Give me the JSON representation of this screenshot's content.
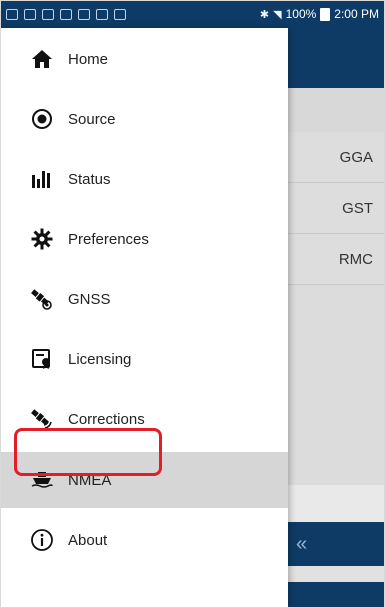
{
  "status_bar": {
    "bluetooth": "✱",
    "signal": "◥",
    "battery": "100%",
    "time": "2:00 PM"
  },
  "drawer": {
    "items": [
      {
        "label": "Home",
        "icon": "home-icon"
      },
      {
        "label": "Source",
        "icon": "source-icon"
      },
      {
        "label": "Status",
        "icon": "status-icon"
      },
      {
        "label": "Preferences",
        "icon": "gear-icon"
      },
      {
        "label": "GNSS",
        "icon": "satellite-icon"
      },
      {
        "label": "Licensing",
        "icon": "license-icon"
      },
      {
        "label": "Corrections",
        "icon": "satellite-corrections-icon"
      },
      {
        "label": "NMEA",
        "icon": "ship-icon"
      },
      {
        "label": "About",
        "icon": "info-icon"
      }
    ],
    "active_item": "NMEA"
  },
  "background_app": {
    "rows": [
      "GGA",
      "GST",
      "RMC"
    ],
    "collapse_symbol": "«"
  },
  "colors": {
    "primary": "#0d3b66",
    "highlight": "#e01f2a",
    "active_bg": "#d6d6d6"
  }
}
